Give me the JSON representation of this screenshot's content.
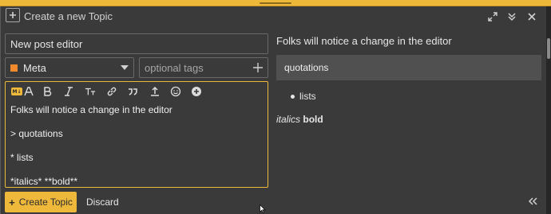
{
  "header": {
    "title": "Create a new Topic"
  },
  "form": {
    "title_value": "New post editor",
    "category": {
      "label": "Meta",
      "color": "#f1892d"
    },
    "tags_placeholder": "optional tags"
  },
  "toolbar": {
    "toggle_label": "M↓",
    "items": [
      "toggle-rich-text",
      "font-size",
      "bold",
      "italic",
      "clear-formatting",
      "link",
      "blockquote",
      "upload",
      "emoji",
      "more"
    ]
  },
  "editor": {
    "lines": [
      "Folks will notice a change in the editor",
      "> quotations",
      "* lists",
      "*italics* **bold**"
    ]
  },
  "preview": {
    "paragraph": "Folks will notice a change in the editor",
    "quote": "quotations",
    "list_item": "lists",
    "italic_text": "italics",
    "bold_text": "bold"
  },
  "footer": {
    "create_label": "Create Topic",
    "discard_label": "Discard"
  },
  "colors": {
    "accent": "#eeb83b",
    "background": "#3a3a3a",
    "quote_background": "#505050"
  }
}
